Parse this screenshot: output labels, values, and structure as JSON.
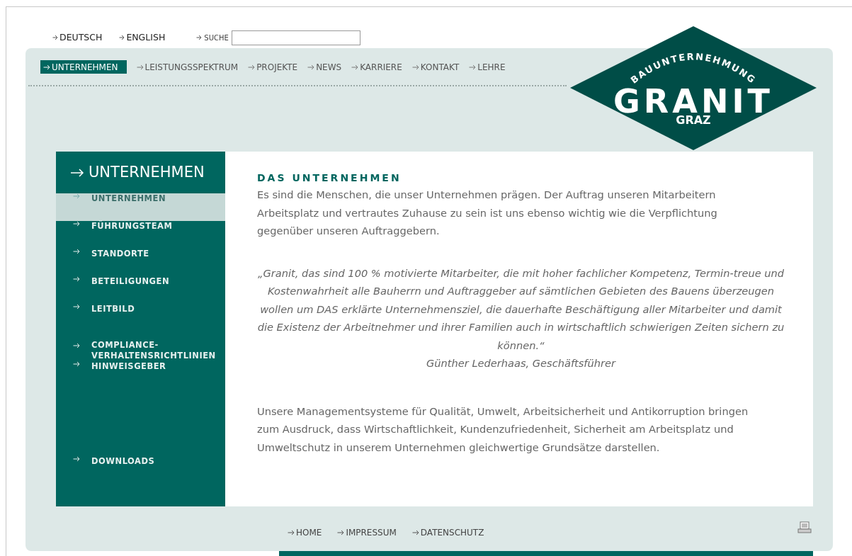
{
  "languages": [
    {
      "label": "DEUTSCH"
    },
    {
      "label": "ENGLISH"
    }
  ],
  "search": {
    "label": "SUCHE"
  },
  "nav": [
    {
      "label": "UNTERNEHMEN",
      "selected": true
    },
    {
      "label": "LEISTUNGSSPEKTRUM",
      "selected": false
    },
    {
      "label": "PROJEKTE",
      "selected": false
    },
    {
      "label": "NEWS",
      "selected": false
    },
    {
      "label": "KARRIERE",
      "selected": false
    },
    {
      "label": "KONTAKT",
      "selected": false
    },
    {
      "label": "LEHRE",
      "selected": false
    }
  ],
  "logo": {
    "top": "BAUUNTERNEHMUNG",
    "main": "GRANIT",
    "bottom": "GRAZ"
  },
  "sidebar": {
    "title": "UNTERNEHMEN",
    "items": [
      {
        "label": "UNTERNEHMEN",
        "selected": true
      },
      {
        "label": "FÜHRUNGSTEAM",
        "selected": false
      },
      {
        "label": "STANDORTE",
        "selected": false
      },
      {
        "label": "BETEILIGUNGEN",
        "selected": false
      },
      {
        "label": "LEITBILD",
        "selected": false
      },
      {
        "label": "COMPLIANCE-\nVERHALTENSRICHTLINIEN",
        "selected": false
      },
      {
        "label": "HINWEISGEBER",
        "selected": false
      }
    ],
    "bottom_items": [
      {
        "label": "DOWNLOADS",
        "selected": false
      }
    ]
  },
  "content": {
    "heading": "DAS UNTERNEHMEN",
    "intro": "Es sind die Menschen, die unser Unternehmen prägen. Der Auftrag unseren Mitarbeitern Arbeitsplatz und vertrautes Zuhause zu sein ist uns ebenso wichtig wie die Verpflichtung gegenüber unseren Auftraggebern.",
    "quote": "„Granit, das sind 100 % motivierte Mitarbeiter, die mit hoher fachlicher Kompetenz, Termin-treue und Kostenwahrheit alle Bauherrn und Auftraggeber auf sämtlichen Gebieten des Bauens überzeugen wollen um DAS erklärte Unternehmensziel, die dauerhafte Beschäftigung aller Mitarbeiter und damit die Existenz der Arbeitnehmer und ihrer Familien auch in wirtschaftlich schwierigen Zeiten sichern zu können.“",
    "quote_author": "Günther Lederhaas, Geschäftsführer",
    "closing": "Unsere Managementsysteme für Qualität, Umwelt, Arbeitsicherheit und Antikorruption bringen zum Ausdruck, dass Wirtschaftlichkeit, Kundenzufriedenheit, Sicherheit am Arbeitsplatz und Umweltschutz in unserem Unternehmen gleichwertige Grundsätze darstellen."
  },
  "footer_links": [
    {
      "label": "HOME"
    },
    {
      "label": "IMPRESSUM"
    },
    {
      "label": "DATENSCHUTZ"
    }
  ]
}
